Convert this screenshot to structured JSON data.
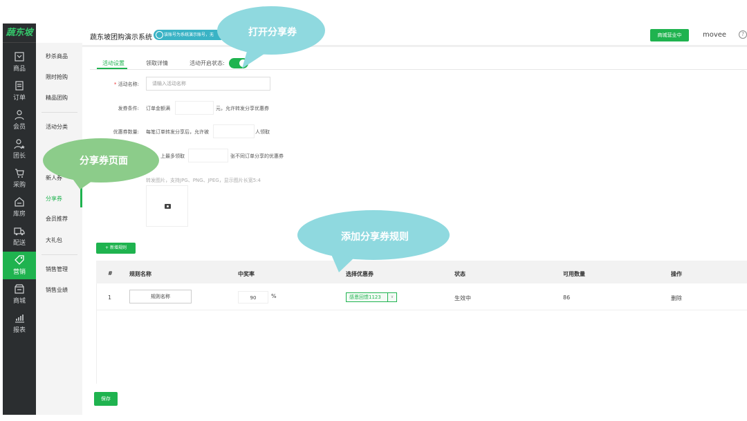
{
  "app": {
    "logo": "蔬东坡",
    "title": "蔬东坡团购演示系统",
    "badge": "该账号为系统演示账号，无",
    "shop_status": "商城营业中",
    "user": "movee",
    "help": "?"
  },
  "sidebar": {
    "items": [
      {
        "label": "商品",
        "icon": "goods-icon"
      },
      {
        "label": "订单",
        "icon": "order-icon"
      },
      {
        "label": "会员",
        "icon": "member-icon"
      },
      {
        "label": "团长",
        "icon": "leader-icon"
      },
      {
        "label": "采购",
        "icon": "purchase-icon"
      },
      {
        "label": "库房",
        "icon": "warehouse-icon"
      },
      {
        "label": "配送",
        "icon": "delivery-icon"
      },
      {
        "label": "营销",
        "icon": "marketing-icon"
      },
      {
        "label": "商城",
        "icon": "mall-icon"
      },
      {
        "label": "报表",
        "icon": "report-icon"
      }
    ]
  },
  "subnav": {
    "items": [
      "秒杀商品",
      "限时抢购",
      "精品团购",
      "活动分类",
      "新人券",
      "分享券",
      "会员推荐",
      "大礼包",
      "销售管理",
      "销售业绩"
    ]
  },
  "tabs": {
    "settings": "活动设置",
    "records": "领取详情",
    "status_label": "活动开启状态:"
  },
  "form": {
    "name_label": "活动名称:",
    "name_placeholder": "请输入活动名称",
    "condition_label": "发券条件:",
    "condition_prefix": "订单金额满",
    "condition_suffix": "元，允许转发分享优惠券",
    "count_label": "优惠券数量:",
    "count_prefix": "每笔订单转发分享后，允许被",
    "count_suffix": "人领取",
    "limit_partial": "上最多领取",
    "limit_suffix": "张不同订单分享的优惠券",
    "image_hint": "转发图片，支持JPG、PNG、JPEG，显示图片长宽5:4"
  },
  "rules": {
    "add_button": "+ 新增规则",
    "headers": [
      "#",
      "规则名称",
      "中奖率",
      "选择优惠券",
      "状态",
      "可用数量",
      "操作"
    ],
    "rows": [
      {
        "index": "1",
        "name": "规则名称",
        "rate": "90",
        "rate_unit": "%",
        "coupon": "感恩回馈1123",
        "coupon_caret": "∨",
        "status": "生效中",
        "available": "86",
        "action": "删除"
      }
    ]
  },
  "save_button": "保存",
  "callouts": {
    "open": "打开分享券",
    "page": "分享券页面",
    "add_rule": "添加分享券规则"
  },
  "colors": {
    "accent": "#1fb34f",
    "sidebar": "#2b2e30",
    "callout_teal": "#8fd9df",
    "callout_green": "#8ccc8a"
  }
}
